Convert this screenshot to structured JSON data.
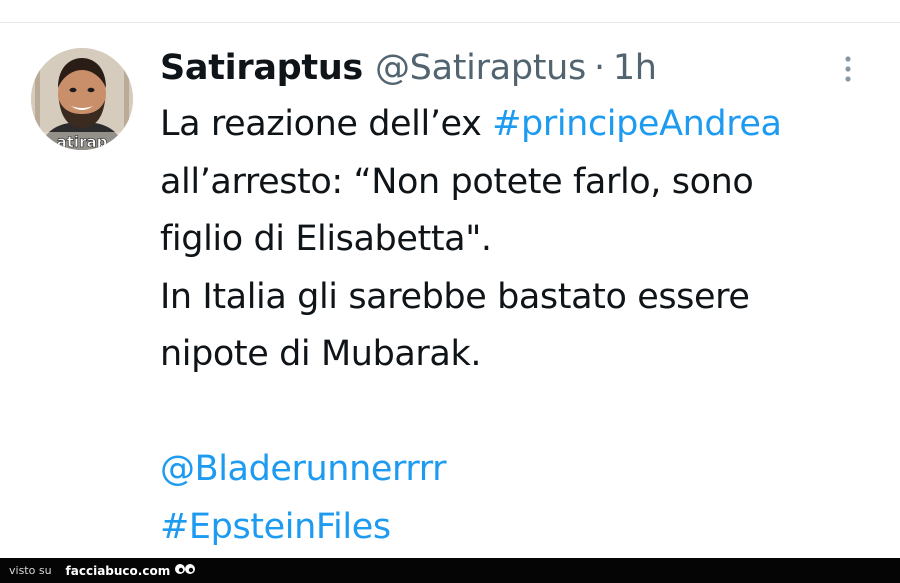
{
  "tweet": {
    "display_name": "Satiraptus",
    "handle": "@Satiraptus",
    "separator": "·",
    "time": "1h",
    "avatar_text": "atirap",
    "lines": {
      "l1_text": "La reazione dell’ex ",
      "l1_hashtag": "#principeAndrea",
      "l2": "all’arresto: “Non potete farlo, sono",
      "l3": "figlio di Elisabetta\".",
      "l4": "In Italia gli sarebbe bastato essere",
      "l5": "nipote di Mubarak."
    },
    "mention": "@Bladerunnerrrr",
    "hashtag": "#EpsteinFiles"
  },
  "colors": {
    "text": "#0f1419",
    "secondary": "#536471",
    "link": "#1d9bf0"
  },
  "watermark": {
    "visto": "visto su",
    "site": "facciabuco.com"
  }
}
